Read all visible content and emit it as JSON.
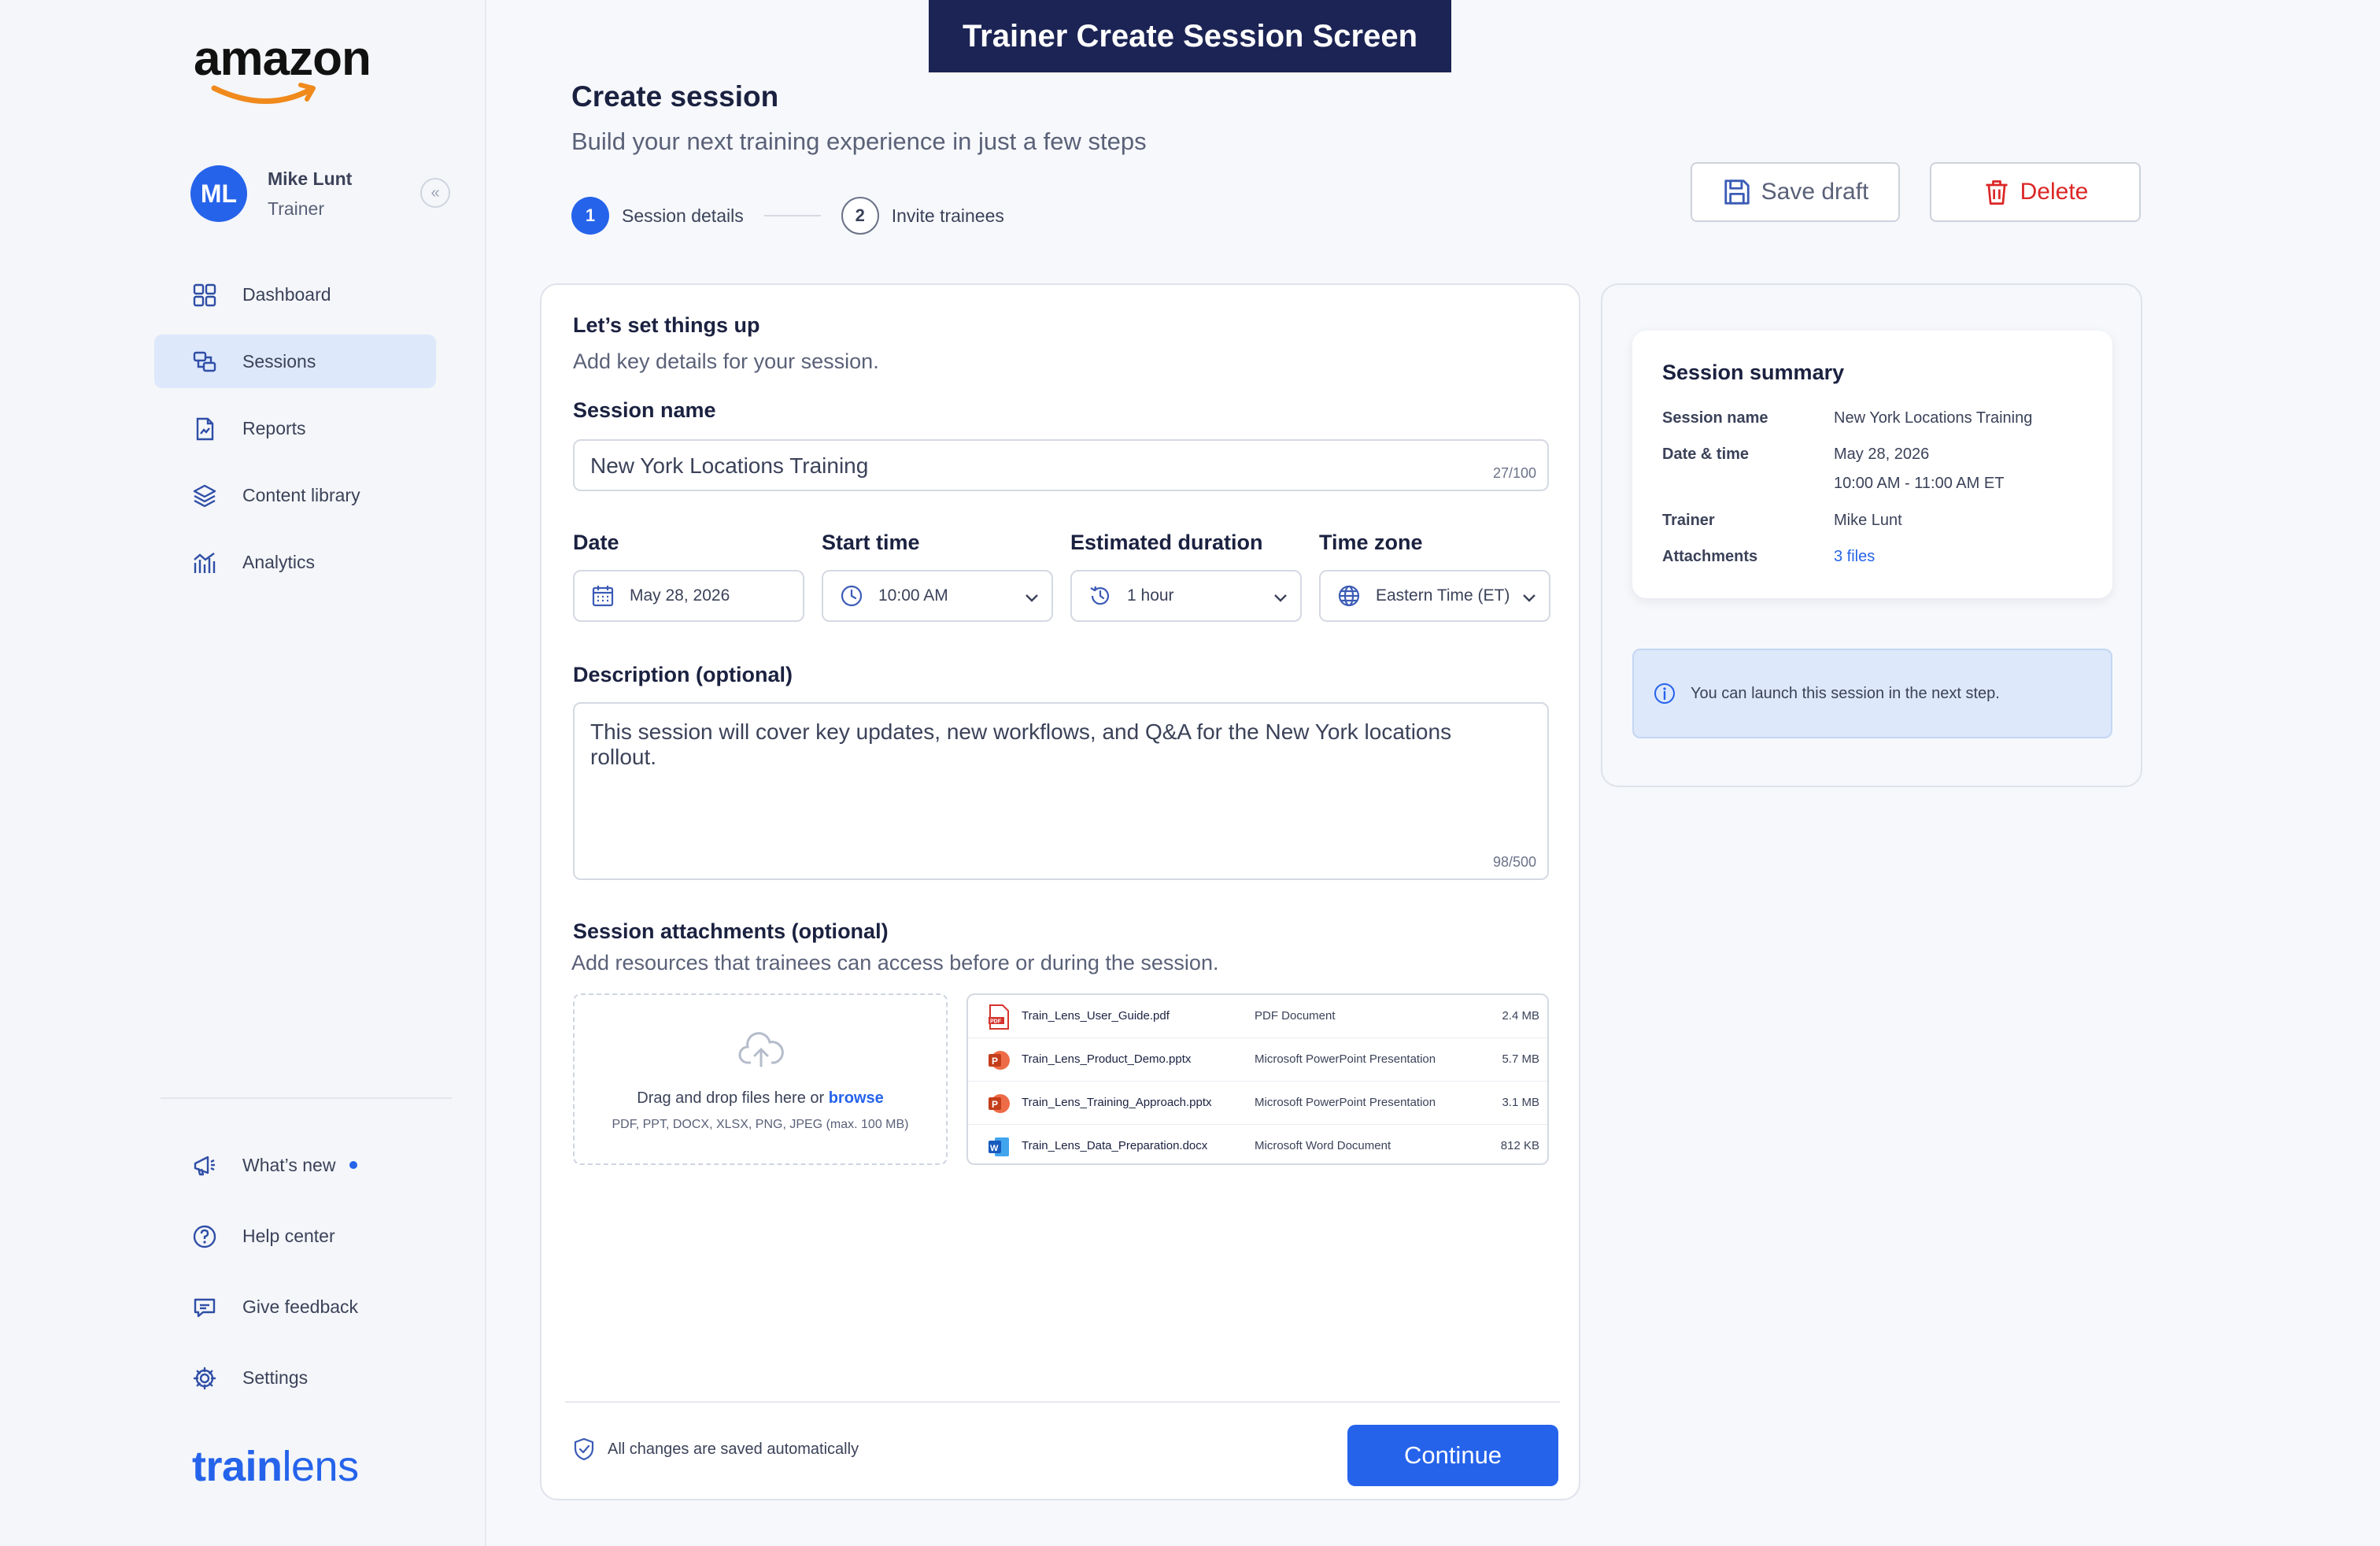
{
  "banner": "Trainer Create Session Screen",
  "brand": {
    "amazon": "amazon",
    "trainlens_a": "train",
    "trainlens_b": "lens",
    "accent": "#2563eb"
  },
  "user": {
    "initials": "ML",
    "name": "Mike Lunt",
    "role": "Trainer"
  },
  "nav": {
    "items": [
      {
        "label": "Dashboard",
        "icon": "grid-icon"
      },
      {
        "label": "Sessions",
        "icon": "sessions-icon",
        "active": true
      },
      {
        "label": "Reports",
        "icon": "report-icon"
      },
      {
        "label": "Content library",
        "icon": "layers-icon"
      },
      {
        "label": "Analytics",
        "icon": "analytics-icon"
      }
    ],
    "bottom": [
      {
        "label": "What’s new",
        "icon": "megaphone-icon"
      },
      {
        "label": "Help center",
        "icon": "help-icon"
      },
      {
        "label": "Give feedback",
        "icon": "feedback-icon"
      },
      {
        "label": "Settings",
        "icon": "gear-icon"
      }
    ]
  },
  "header": {
    "title": "Create session",
    "subtitle": "Build your next training experience in just a few steps",
    "steps": [
      {
        "num": "1",
        "label": "Session details"
      },
      {
        "num": "2",
        "label": "Invite trainees"
      }
    ],
    "save_label": "Save draft",
    "delete_label": "Delete"
  },
  "form": {
    "title": "Let’s set things up",
    "subtitle": "Add key details for your session.",
    "session_name_label": "Session name",
    "session_name_value": "New York Locations Training",
    "session_name_counter": "27/100",
    "date_label": "Date",
    "date_value": "May 28, 2026",
    "start_label": "Start time",
    "start_value": "10:00 AM",
    "duration_label": "Estimated duration",
    "duration_value": "1 hour",
    "tz_label": "Time zone",
    "tz_value": "Eastern Time (ET)",
    "desc_label": "Description (optional)",
    "desc_value": "This session will cover key updates, new workflows, and Q&A for the New York locations rollout.",
    "desc_counter": "98/500",
    "attach_label": "Session attachments (optional)",
    "attach_sub": "Add resources that trainees can access before or during the session.",
    "dropzone_text": "Drag and drop files here or ",
    "dropzone_link": "browse",
    "dropzone_formats": "PDF, PPT, DOCX, XLSX, PNG, JPEG (max. 100 MB)",
    "files": [
      {
        "name": "Train_Lens_User_Guide.pdf",
        "type": "PDF Document",
        "size": "2.4 MB",
        "icon": "pdf-icon"
      },
      {
        "name": "Train_Lens_Product_Demo.pptx",
        "type": "Microsoft PowerPoint Presentation",
        "size": "5.7 MB",
        "icon": "powerpoint-icon"
      },
      {
        "name": "Train_Lens_Training_Approach.pptx",
        "type": "Microsoft PowerPoint Presentation",
        "size": "3.1 MB",
        "icon": "powerpoint-icon"
      },
      {
        "name": "Train_Lens_Data_Preparation.docx",
        "type": "Microsoft Word Document",
        "size": "812 KB",
        "icon": "word-icon"
      }
    ],
    "autosave": "All changes are saved automatically",
    "continue_label": "Continue"
  },
  "summary": {
    "title": "Session summary",
    "name_k": "Session name",
    "name_v": "New York Locations Training",
    "date_k": "Date & time",
    "date_v": "May 28, 2026",
    "time_v": "10:00 AM - 11:00 AM ET",
    "trainer_k": "Trainer",
    "trainer_v": "Mike Lunt",
    "attach_k": "Attachments",
    "attach_v": "3 files",
    "notice": "You can launch this session in the next step."
  }
}
